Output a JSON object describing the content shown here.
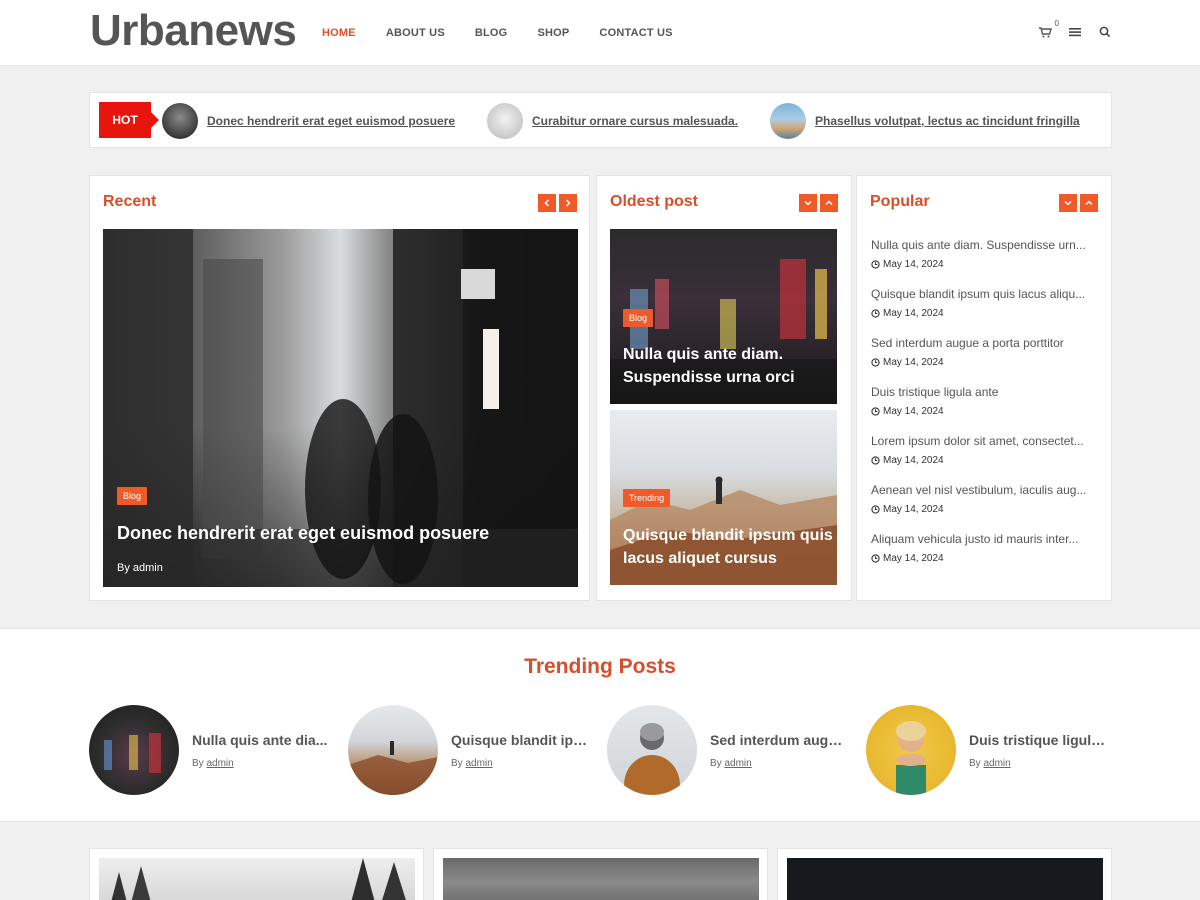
{
  "header": {
    "logo": "Urbanews",
    "nav": [
      "HOME",
      "ABOUT US",
      "BLOG",
      "SHOP",
      "CONTACT US"
    ],
    "cart_count": "0"
  },
  "ticker": {
    "badge": "HOT",
    "items": [
      "Donec hendrerit erat eget euismod posuere",
      "Curabitur ornare cursus malesuada.",
      "Phasellus volutpat, lectus ac tincidunt fringilla"
    ]
  },
  "recent": {
    "title": "Recent",
    "tag": "Blog",
    "post_title": "Donec hendrerit erat eget euismod posuere",
    "byline_prefix": "By",
    "author": "admin"
  },
  "oldest": {
    "title": "Oldest post",
    "posts": [
      {
        "tag": "Blog",
        "title": "Nulla quis ante diam. Suspendisse urna orci"
      },
      {
        "tag": "Trending",
        "title": "Quisque blandit ipsum quis lacus aliquet cursus"
      }
    ]
  },
  "popular": {
    "title": "Popular",
    "items": [
      {
        "title": "Nulla quis ante diam. Suspendisse urn...",
        "date": "May 14, 2024"
      },
      {
        "title": "Quisque blandit ipsum quis lacus aliqu...",
        "date": "May 14, 2024"
      },
      {
        "title": "Sed interdum augue a porta porttitor",
        "date": "May 14, 2024"
      },
      {
        "title": "Duis tristique ligula ante",
        "date": "May 14, 2024"
      },
      {
        "title": "Lorem ipsum dolor sit amet, consectet...",
        "date": "May 14, 2024"
      },
      {
        "title": "Aenean vel nisl vestibulum, iaculis aug...",
        "date": "May 14, 2024"
      },
      {
        "title": "Aliquam vehicula justo id mauris inter...",
        "date": "May 14, 2024"
      }
    ]
  },
  "trending": {
    "heading": "Trending Posts",
    "byline_prefix": "By",
    "items": [
      {
        "title": "Nulla quis ante dia...",
        "author": "admin"
      },
      {
        "title": "Quisque blandit ipsu...",
        "author": "admin"
      },
      {
        "title": "Sed interdum augue...",
        "author": "admin"
      },
      {
        "title": "Duis tristique ligula ...",
        "author": "admin"
      }
    ]
  },
  "icons": {
    "cart": "cart-icon",
    "menu": "hamburger-icon",
    "search": "search-icon",
    "prev": "chevron-left-icon",
    "next": "chevron-right-icon",
    "down": "chevron-down-icon",
    "up": "chevron-up-icon",
    "clock": "clock-icon"
  },
  "colors": {
    "accent": "#d94e2a",
    "button": "#f05a28",
    "hot": "#e8150f"
  }
}
